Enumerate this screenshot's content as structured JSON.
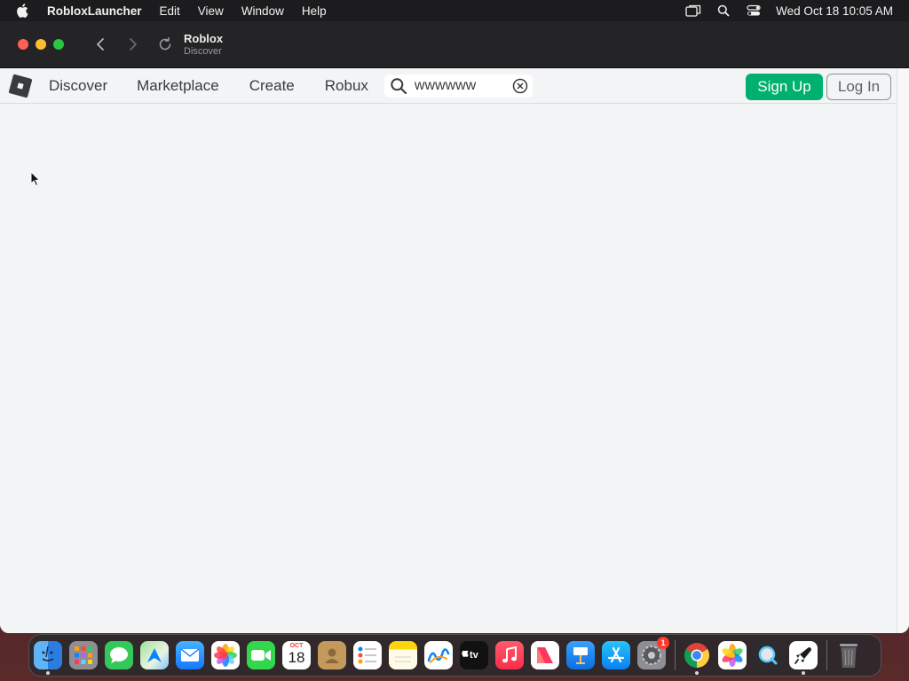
{
  "menubar": {
    "app_name": "RobloxLauncher",
    "items": [
      "Edit",
      "View",
      "Window",
      "Help"
    ],
    "clock": "Wed Oct 18  10:05 AM"
  },
  "window": {
    "title": "Roblox",
    "subtitle": "Discover"
  },
  "roblox_nav": {
    "links": [
      "Discover",
      "Marketplace",
      "Create",
      "Robux"
    ],
    "search_value": "wwwwww",
    "signup_label": "Sign Up",
    "login_label": "Log In"
  },
  "dock": {
    "calendar_month": "OCT",
    "calendar_day": "18",
    "settings_badge": "1",
    "apps": [
      "finder",
      "launchpad",
      "messages",
      "maps",
      "mail",
      "photos",
      "facetime",
      "calendar",
      "contacts",
      "reminders",
      "notes",
      "freeform",
      "tv",
      "music",
      "news",
      "keynote",
      "app-store",
      "system-settings",
      "chrome",
      "photos",
      "quicktime",
      "roblox-launcher",
      "trash"
    ]
  },
  "colors": {
    "signup": "#00b06f",
    "menubar": "#1c1c1e",
    "page_bg": "#f2f4f5"
  }
}
